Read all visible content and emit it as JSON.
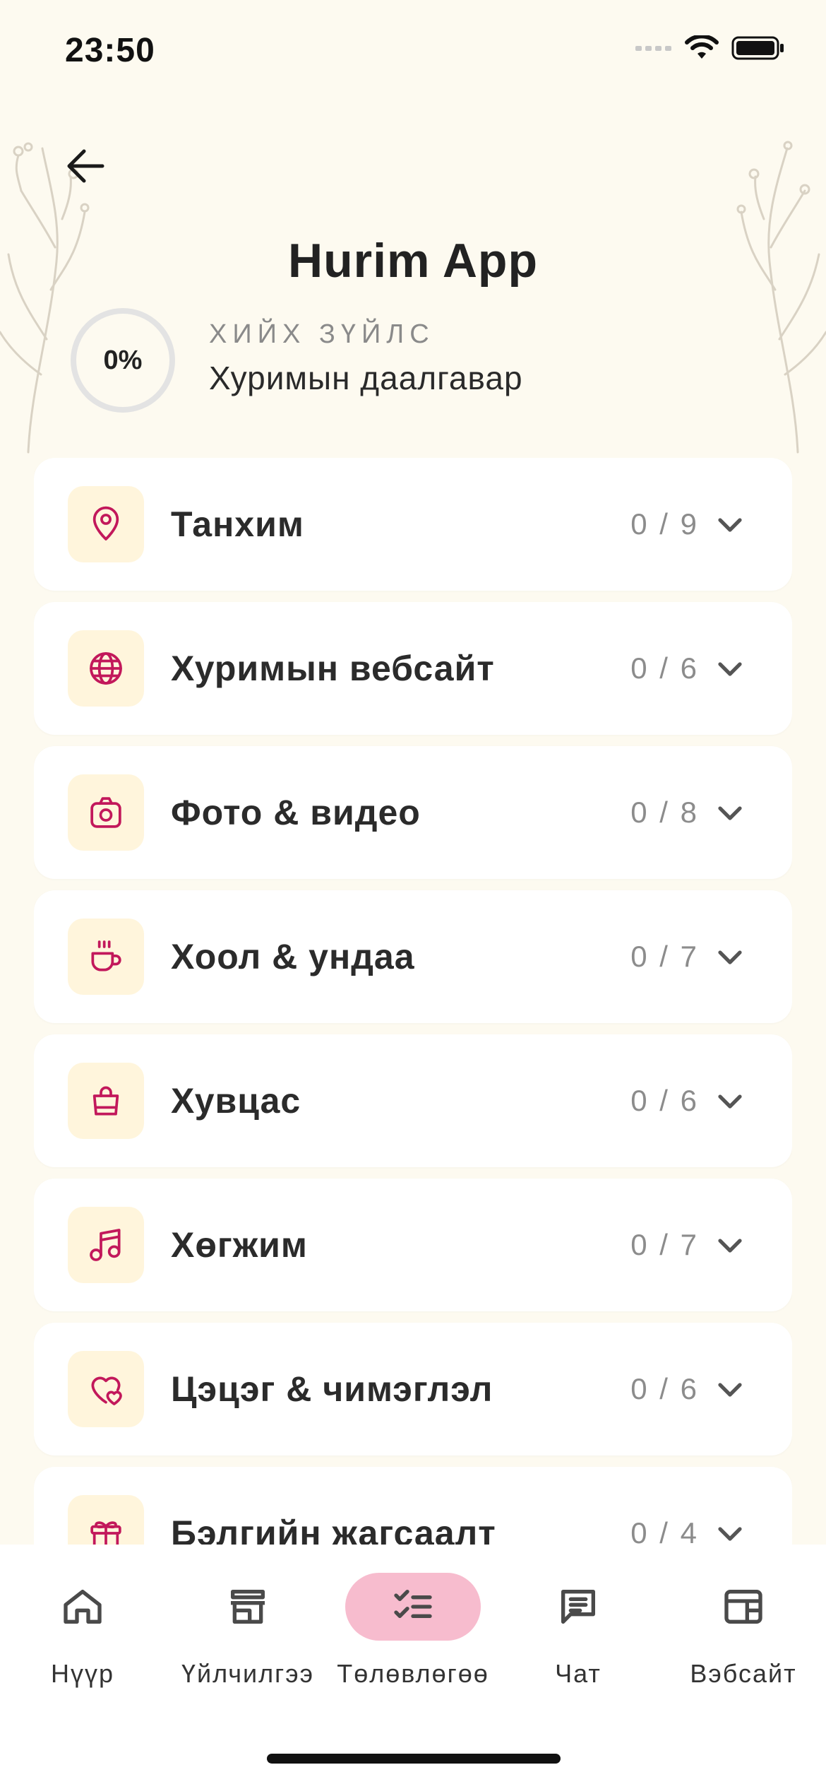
{
  "status_bar": {
    "time": "23:50"
  },
  "header": {
    "title": "Hurim App",
    "progress": "0%",
    "subtitle": "ХИЙХ ЗҮЙЛС",
    "section_title": "Хуримын даалгавар"
  },
  "categories": [
    {
      "label": "Танхим",
      "count": "0 / 9",
      "icon": "location-pin-icon"
    },
    {
      "label": "Хуримын вебсайт",
      "count": "0 / 6",
      "icon": "globe-icon"
    },
    {
      "label": "Фото & видео",
      "count": "0 / 8",
      "icon": "camera-icon"
    },
    {
      "label": "Хоол & ундаа",
      "count": "0 / 7",
      "icon": "coffee-cup-icon"
    },
    {
      "label": "Хувцас",
      "count": "0 / 6",
      "icon": "bag-icon"
    },
    {
      "label": "Хөгжим",
      "count": "0 / 7",
      "icon": "music-note-icon"
    },
    {
      "label": "Цэцэг & чимэглэл",
      "count": "0 / 6",
      "icon": "hearts-icon"
    },
    {
      "label": "Бэлгийн жагсаалт",
      "count": "0 / 4",
      "icon": "gift-icon"
    }
  ],
  "bottom_nav": [
    {
      "label": "Нүүр",
      "icon": "home-icon"
    },
    {
      "label": "Үйлчилгээ",
      "icon": "store-icon"
    },
    {
      "label": "Төлөвлөгөө",
      "icon": "checklist-icon",
      "active": true
    },
    {
      "label": "Чат",
      "icon": "chat-icon"
    },
    {
      "label": "Вэбсайт",
      "icon": "website-icon"
    }
  ],
  "colors": {
    "background": "#FDFAF0",
    "accent": "#C2185B",
    "icon_box": "#FFF5DC",
    "active_nav_pill": "#F7BCCE"
  }
}
